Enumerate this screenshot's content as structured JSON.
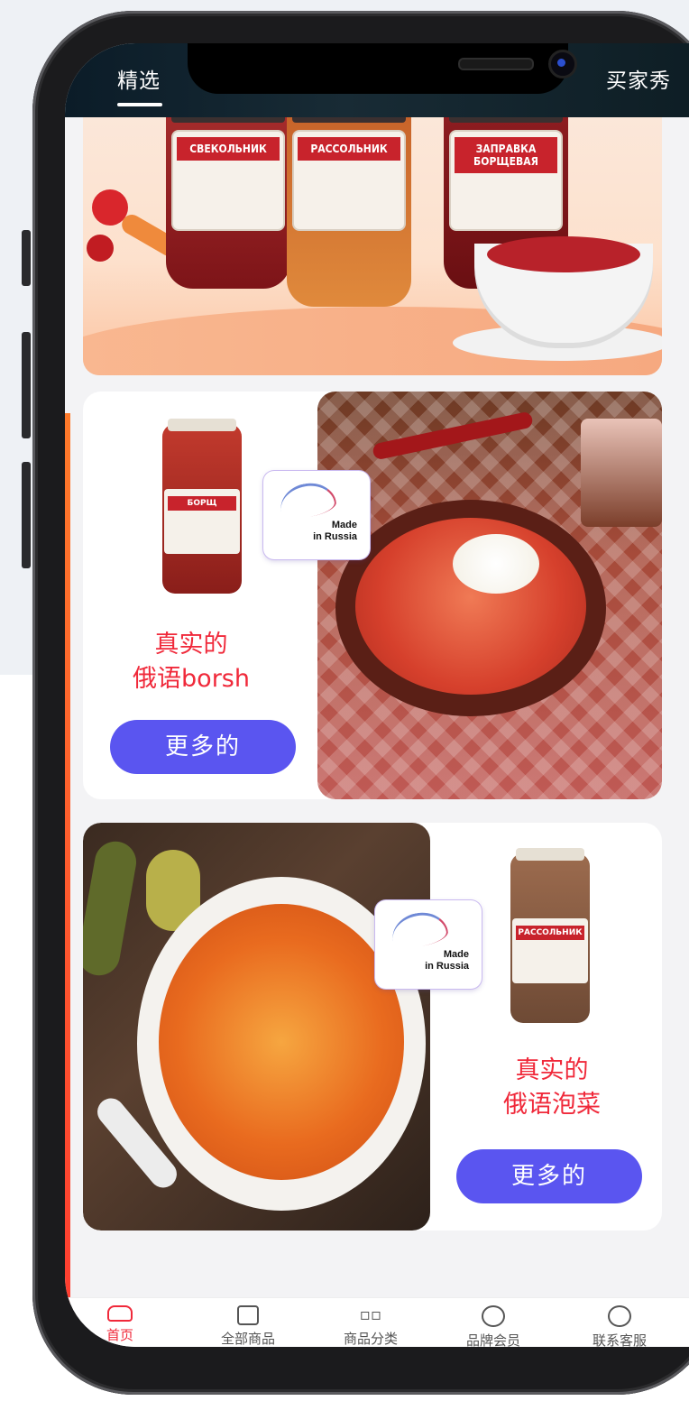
{
  "top_tabs": {
    "featured": "精选",
    "buyer_show": "买家秀"
  },
  "hero": {
    "jar_labels": [
      "СВЕКОЛЬНИК",
      "РАССОЛЬНИК",
      "ЗАПРАВКА БОРЩЕВАЯ"
    ]
  },
  "cards": [
    {
      "jar_label": "БОРЩ",
      "badge": "Made\nin Russia",
      "title_line1": "真实的",
      "title_line2": "俄语borsh",
      "button": "更多的"
    },
    {
      "jar_label": "РАССОЛЬНИК",
      "badge": "Made\nin Russia",
      "title_line1": "真实的",
      "title_line2": "俄语泡菜",
      "button": "更多的"
    }
  ],
  "bottom_nav": [
    {
      "label": "首页",
      "icon": "home-icon",
      "active": true
    },
    {
      "label": "全部商品",
      "icon": "shopping-bag-icon",
      "active": false
    },
    {
      "label": "商品分类",
      "icon": "category-grid-icon",
      "active": false
    },
    {
      "label": "品牌会员",
      "icon": "member-icon",
      "active": false
    },
    {
      "label": "联系客服",
      "icon": "chat-icon",
      "active": false
    }
  ],
  "colors": {
    "accent_red": "#f0293a",
    "button_purple": "#5a55f0"
  }
}
